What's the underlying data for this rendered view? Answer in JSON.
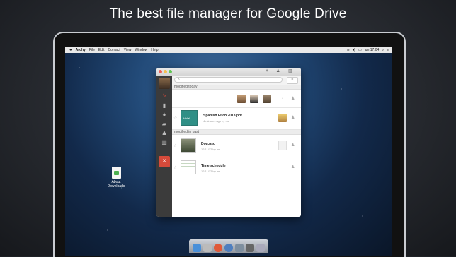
{
  "headline": "The best file manager for Google Drive",
  "menubar": {
    "apple": "",
    "items": [
      "Archy",
      "File",
      "Edit",
      "Contact",
      "View",
      "Window",
      "Help"
    ],
    "clock": "lun 17:04"
  },
  "desktop": {
    "file_label_1": "About",
    "file_label_2": "Downloads"
  },
  "app": {
    "toolbar": {
      "add_icon": "+",
      "share_icon": "👤",
      "trash_icon": "🗑"
    },
    "search": {
      "placeholder": ""
    },
    "sections": {
      "today": "modified today",
      "past": "modified in past"
    },
    "files": [
      {
        "name": "Spanish Pitch 2013.pdf",
        "meta": "4 minutes ago by me",
        "thumb_text": "Hola!"
      },
      {
        "name": "Dog.psd",
        "meta": "12/11/12 by me"
      },
      {
        "name": "Time schedule",
        "meta": "12/11/12 by me"
      }
    ],
    "colors": {
      "sidebar": "#3b3b3b",
      "accent_red": "#d64a3a",
      "thumb_teal": "#2f8f86"
    }
  }
}
